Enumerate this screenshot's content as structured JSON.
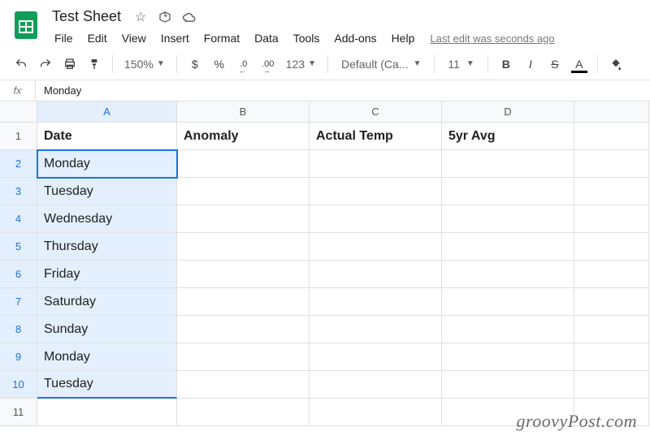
{
  "doc": {
    "title": "Test Sheet"
  },
  "menu": {
    "file": "File",
    "edit": "Edit",
    "view": "View",
    "insert": "Insert",
    "format": "Format",
    "data": "Data",
    "tools": "Tools",
    "addons": "Add-ons",
    "help": "Help",
    "last_edit": "Last edit was seconds ago"
  },
  "toolbar": {
    "zoom": "150%",
    "currency": "$",
    "percent": "%",
    "dec_dec": ".0",
    "inc_dec": ".00",
    "more_formats": "123",
    "font": "Default (Ca...",
    "font_size": "11",
    "bold": "B",
    "italic": "I",
    "strike": "S",
    "text_color": "A"
  },
  "formula": {
    "fx": "fx",
    "content": "Monday"
  },
  "columns": {
    "A": "A",
    "B": "B",
    "C": "C",
    "D": "D"
  },
  "rows": [
    "1",
    "2",
    "3",
    "4",
    "5",
    "6",
    "7",
    "8",
    "9",
    "10",
    "11"
  ],
  "grid": {
    "A1": "Date",
    "B1": "Anomaly",
    "C1": "Actual Temp",
    "D1": "5yr Avg",
    "A2": "Monday",
    "A3": "Tuesday",
    "A4": "Wednesday",
    "A5": "Thursday",
    "A6": "Friday",
    "A7": "Saturday",
    "A8": "Sunday",
    "A9": "Monday",
    "A10": "Tuesday"
  },
  "watermark": "groovyPost.com"
}
